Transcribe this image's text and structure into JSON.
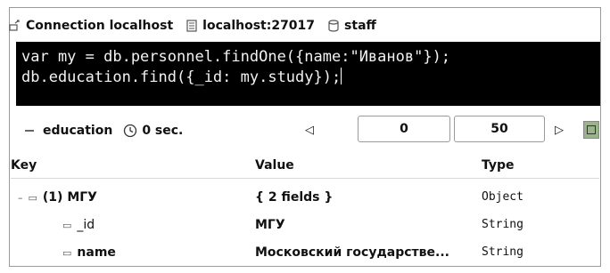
{
  "connection": {
    "label": "Connection localhost",
    "server": "localhost:27017",
    "database": "staff",
    "icons": [
      "connection-icon",
      "server-icon",
      "database-icon"
    ]
  },
  "editor": {
    "lines": [
      "var my = db.personnel.findOne({name:\"Иванов\"});",
      "db.education.find({_id: my.study});"
    ]
  },
  "toolbar": {
    "collection": "education",
    "time": "0 sec.",
    "skip_value": "0",
    "limit_value": "50"
  },
  "grid": {
    "headers": {
      "key": "Key",
      "value": "Value",
      "type": "Type"
    },
    "rows": [
      {
        "key": "(1) МГУ",
        "value": "{ 2 fields }",
        "type": "Object"
      },
      {
        "key": "_id",
        "value": "МГУ",
        "type": "String"
      },
      {
        "key": "name",
        "value": "Московский государстве...",
        "type": "String"
      }
    ]
  }
}
